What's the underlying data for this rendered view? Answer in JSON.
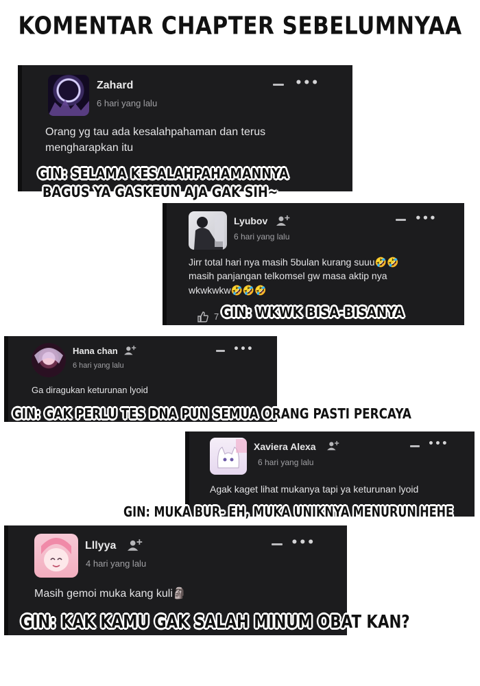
{
  "page": {
    "title": "KOMENTAR CHAPTER SEBELUMNYAA"
  },
  "comments": [
    {
      "username": "Zahard",
      "time": "6 hari yang lalu",
      "text_lines": [
        "Orang yg tau ada kesalahpahaman dan terus",
        "mengharapkan itu"
      ],
      "avatar_icon": "dark-ring-avatar",
      "caption_lines": [
        "GIN: SELAMA KESALAHPAHAMANNYA",
        "BAGUS YA GASKEUN AJA GAK SIH~"
      ]
    },
    {
      "username": "Lyubov",
      "time": "6 hari yang lalu",
      "text_lines": [
        "Jirr total hari nya masih 5bulan kurang suuu🤣🤣",
        "masih panjangan telkomsel gw masa aktip nya",
        "wkwkwkw🤣🤣🤣"
      ],
      "like_count": "7",
      "avatar_icon": "person-sitting-avatar",
      "caption_lines": [
        "GIN: WKWK BISA-BISANYA"
      ]
    },
    {
      "username": "Hana chan",
      "time": "6 hari yang lalu",
      "text_lines": [
        "Ga diragukan keturunan lyoid"
      ],
      "avatar_icon": "anime-girl-avatar",
      "caption_lines": [
        "GIN: GAK PERLU TES DNA PUN SEMUA ORANG PASTI PERCAYA"
      ]
    },
    {
      "username": "Xaviera Alexa",
      "time": "6 hari yang lalu",
      "text_lines": [
        "Agak kaget lihat mukanya tapi ya keturunan lyoid"
      ],
      "avatar_icon": "white-cat-avatar",
      "caption_lines": [
        "GIN: MUKA BUR- EH, MUKA UNIKNYA MENURUN HEHE"
      ]
    },
    {
      "username": "Lllyya",
      "time": "4 hari yang lalu",
      "text_lines": [
        "Masih gemoi muka kang kuli🗿"
      ],
      "avatar_icon": "pink-hair-girl-avatar",
      "caption_lines": [
        "GIN: KAK KAMU GAK SALAH MINUM OBAT KAN?"
      ]
    }
  ],
  "icons": {
    "more": "•••",
    "add_friend": "add-friend-icon",
    "like": "thumbs-up-icon"
  },
  "colors": {
    "card_bg": "#1c1c1e",
    "name": "#e9e9ea",
    "time": "#a0a0a4",
    "caption": "#111111"
  }
}
